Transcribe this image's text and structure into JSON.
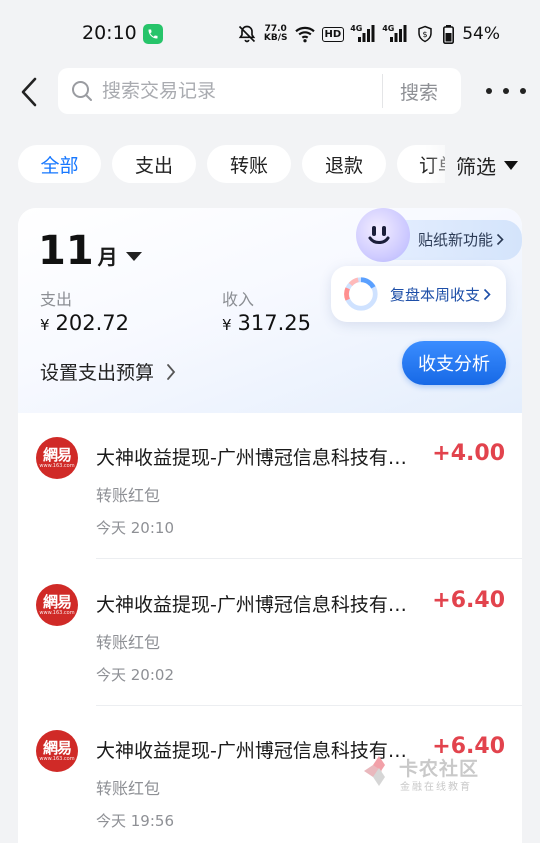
{
  "status_bar": {
    "time": "20:10",
    "net_speed_value": "77.0",
    "net_speed_unit": "KB/S",
    "hd_label": "HD",
    "signal1_label": "4G",
    "signal2_label": "4G",
    "battery_percent": "54%"
  },
  "header": {
    "search_placeholder": "搜索交易记录",
    "search_button": "搜索"
  },
  "filters": {
    "chips": [
      "全部",
      "支出",
      "转账",
      "退款",
      "订单"
    ],
    "active_index": 0,
    "filter_button": "筛选"
  },
  "summary": {
    "month_number": "11",
    "month_unit": "月",
    "expense_label": "支出",
    "expense_currency": "¥",
    "expense_amount": "202.72",
    "income_label": "收入",
    "income_currency": "¥",
    "income_amount": "317.25",
    "budget_label": "设置支出预算",
    "sticker_text": "贴纸新功能",
    "weekly_review": "复盘本周收支",
    "analysis_button": "收支分析"
  },
  "transactions": [
    {
      "logo_text": "網易",
      "logo_sub": "www.163.com",
      "title": "大神收益提现-广州博冠信息科技有…",
      "amount": "+4.00",
      "category": "转账红包",
      "time": "今天 20:10"
    },
    {
      "logo_text": "網易",
      "logo_sub": "www.163.com",
      "title": "大神收益提现-广州博冠信息科技有…",
      "amount": "+6.40",
      "category": "转账红包",
      "time": "今天 20:02"
    },
    {
      "logo_text": "網易",
      "logo_sub": "www.163.com",
      "title": "大神收益提现-广州博冠信息科技有…",
      "amount": "+6.40",
      "category": "转账红包",
      "time": "今天 19:56"
    }
  ],
  "watermark": {
    "title": "卡农社区",
    "subtitle": "金融在线教育"
  },
  "colors": {
    "accent": "#1677ff",
    "income_amount": "#e2434d",
    "logo_bg": "#d02a27",
    "page_bg": "#f2f3f5"
  }
}
